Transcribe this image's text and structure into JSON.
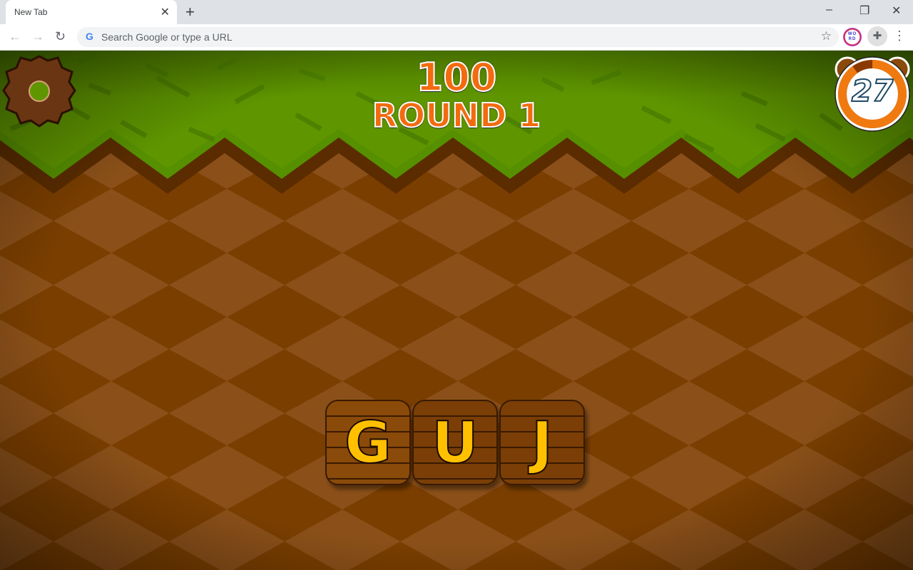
{
  "browser": {
    "tab_title": "New Tab",
    "omnibox_placeholder": "Search Google or type a URL",
    "extension_label": "WORD"
  },
  "game": {
    "score": "100",
    "round": "ROUND 1",
    "timer": "27",
    "timer_fraction": 0.9,
    "letters": [
      "G",
      "U",
      "J"
    ],
    "colors": {
      "grass": "#5f9600",
      "dirt_dark": "#7a3e00",
      "dirt_light": "#8b5019",
      "letter": "#ffc000",
      "score": "#f26b0f"
    }
  }
}
